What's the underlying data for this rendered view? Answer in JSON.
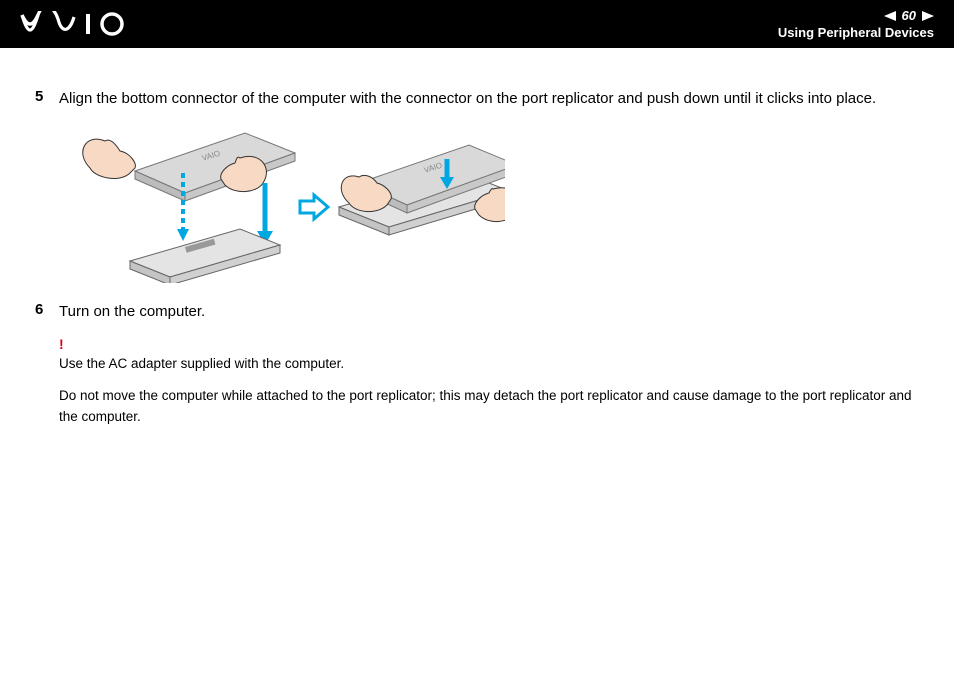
{
  "header": {
    "page_number": "60",
    "section_title": "Using Peripheral Devices"
  },
  "steps": [
    {
      "number": "5",
      "text": "Align the bottom connector of the computer with the connector on the port replicator and push down until it clicks into place."
    },
    {
      "number": "6",
      "text": "Turn on the computer."
    }
  ],
  "warning": {
    "line1": "Use the AC adapter supplied with the computer.",
    "line2": "Do not move the computer while attached to the port replicator; this may detach the port replicator and cause damage to the port replicator and the computer."
  }
}
